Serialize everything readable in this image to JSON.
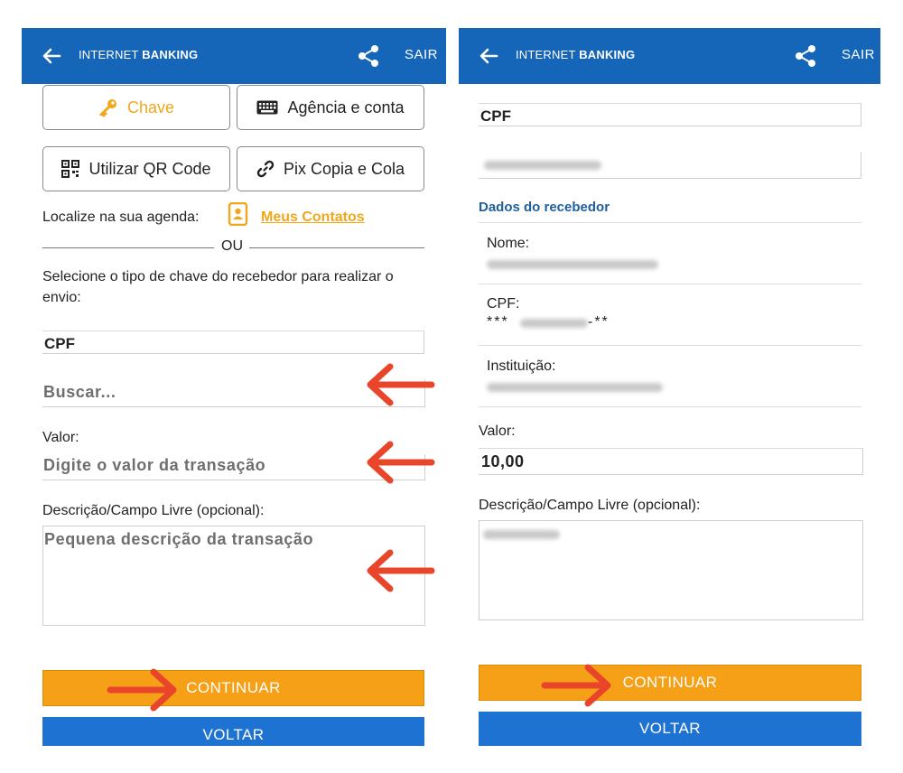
{
  "header": {
    "brand_light": "INTERNET",
    "brand_bold": "BANKING",
    "exit_label": "SAIR"
  },
  "left": {
    "key_button": "Chave",
    "branch_button": "Agência e conta",
    "qr_button": "Utilizar QR Code",
    "pix_copy_button": "Pix Copia e Cola",
    "agenda_prompt": "Localize na sua agenda:",
    "contacts_link": "Meus Contatos",
    "or_label": "OU",
    "instruction": "Selecione o tipo de chave do recebedor para realizar o envio:",
    "key_type_value": "CPF",
    "search_placeholder": "Buscar...",
    "value_label": "Valor:",
    "value_placeholder": "Digite o valor da transação",
    "description_label": "Descrição/Campo Livre (opcional):",
    "description_placeholder": "Pequena descrição da transação",
    "continue_button": "CONTINUAR",
    "back_button": "VOLTAR"
  },
  "right": {
    "key_type_value": "CPF",
    "receiver_section_title": "Dados do recebedor",
    "name_label": "Nome:",
    "cpf_label": "CPF:",
    "cpf_masked_start": "***",
    "cpf_masked_end": "-**",
    "institution_label": "Instituição:",
    "value_label": "Valor:",
    "value": "10,00",
    "description_label": "Descrição/Campo Livre (opcional):",
    "continue_button": "CONTINUAR",
    "back_button": "VOLTAR"
  },
  "colors": {
    "header_blue": "#1565b8",
    "accent_orange": "#f5a016",
    "button_blue": "#1e73d2",
    "link_orange": "#f0a81a",
    "arrow_red": "#e8452a",
    "section_blue": "#1f5f9c"
  }
}
